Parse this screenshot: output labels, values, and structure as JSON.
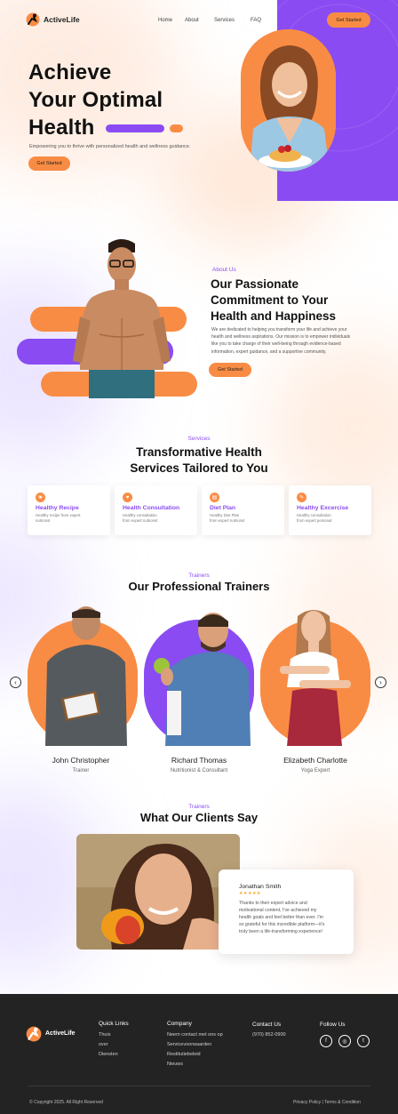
{
  "colors": {
    "purple": "#8a4cf2",
    "orange": "#f98c44",
    "footer_bg": "#232323"
  },
  "brand": {
    "name": "ActiveLife"
  },
  "nav": {
    "items": [
      "Home",
      "About",
      "Services",
      "FAQ"
    ],
    "cta": "Get Started"
  },
  "hero": {
    "title_lines": [
      "Achieve",
      "Your Optimal",
      "Health"
    ],
    "subtitle": "Empowering you to thrive with personalized health and wellness guidance.",
    "cta": "Get Started"
  },
  "about": {
    "tag": "About Us",
    "title_lines": [
      "Our Passionate",
      "Commitment to Your",
      "Health and Happiness"
    ],
    "body_lines": [
      "We are dedicated to helping you transform your life and achieve your",
      "health and wellness aspirations. Our mission is to empower individuals",
      "like you to take charge of their well-being through evidence-based",
      "information, expert guidance, and a supportive community."
    ],
    "cta": "Get Started"
  },
  "services": {
    "tag": "Services",
    "title_lines": [
      "Transformative Health",
      "Services Tailored to You"
    ],
    "cards": [
      {
        "title": "Healthy Recipe",
        "desc": [
          "Healthy recipe from expert",
          "nutrionst"
        ],
        "icon": "leaf-icon"
      },
      {
        "title": "Health Consultation",
        "desc": [
          "Healthy consultation",
          "from expert nutrionst"
        ],
        "icon": "heart-icon"
      },
      {
        "title": "Diet Plan",
        "desc": [
          "Healthy Diet Plan",
          "from expert nutrionst"
        ],
        "icon": "clipboard-icon"
      },
      {
        "title": "Healthy Excercise",
        "desc": [
          "Healthy consultation",
          "from expert personal"
        ],
        "icon": "dumbbell-icon"
      }
    ]
  },
  "trainers": {
    "tag": "Trainers",
    "title": "Our Professional Trainers",
    "items": [
      {
        "name": "John Christopher",
        "role": "Trainer"
      },
      {
        "name": "Richard Thomas",
        "role": "Nutritionist & Consultant"
      },
      {
        "name": "Elizabeth Charlotte",
        "role": "Yoga Expert"
      }
    ],
    "prev": "‹",
    "next": "›"
  },
  "testimonials": {
    "tag": "Trainers",
    "title": "What Our Clients Say",
    "name": "Jonathan Smith",
    "stars": "★★★★★",
    "text_lines": [
      "Thanks to their expert advice and",
      "motivational content, I've achieved my",
      "health goals and feel better than ever. I'm",
      "so grateful for this incredible platform—it's",
      "truly been a life-transforming experience!"
    ]
  },
  "footer": {
    "quick_links": {
      "heading": "Quick Links",
      "items": [
        "Thuis",
        "over",
        "Diensten"
      ]
    },
    "company": {
      "heading": "Company",
      "items": [
        "Neem contact met ons op",
        "Servicevoorwaarden",
        "Restitutiebeleid",
        "Nieuws"
      ]
    },
    "contact": {
      "heading": "Contact Us",
      "phone": "(970) 852-0900"
    },
    "follow": {
      "heading": "Follow Us",
      "icons": [
        "f",
        "◎",
        "t"
      ]
    },
    "copyright": "© Copyright 2025. All Right Reserved",
    "legal": "Privacy Policy | Terms & Condition"
  }
}
